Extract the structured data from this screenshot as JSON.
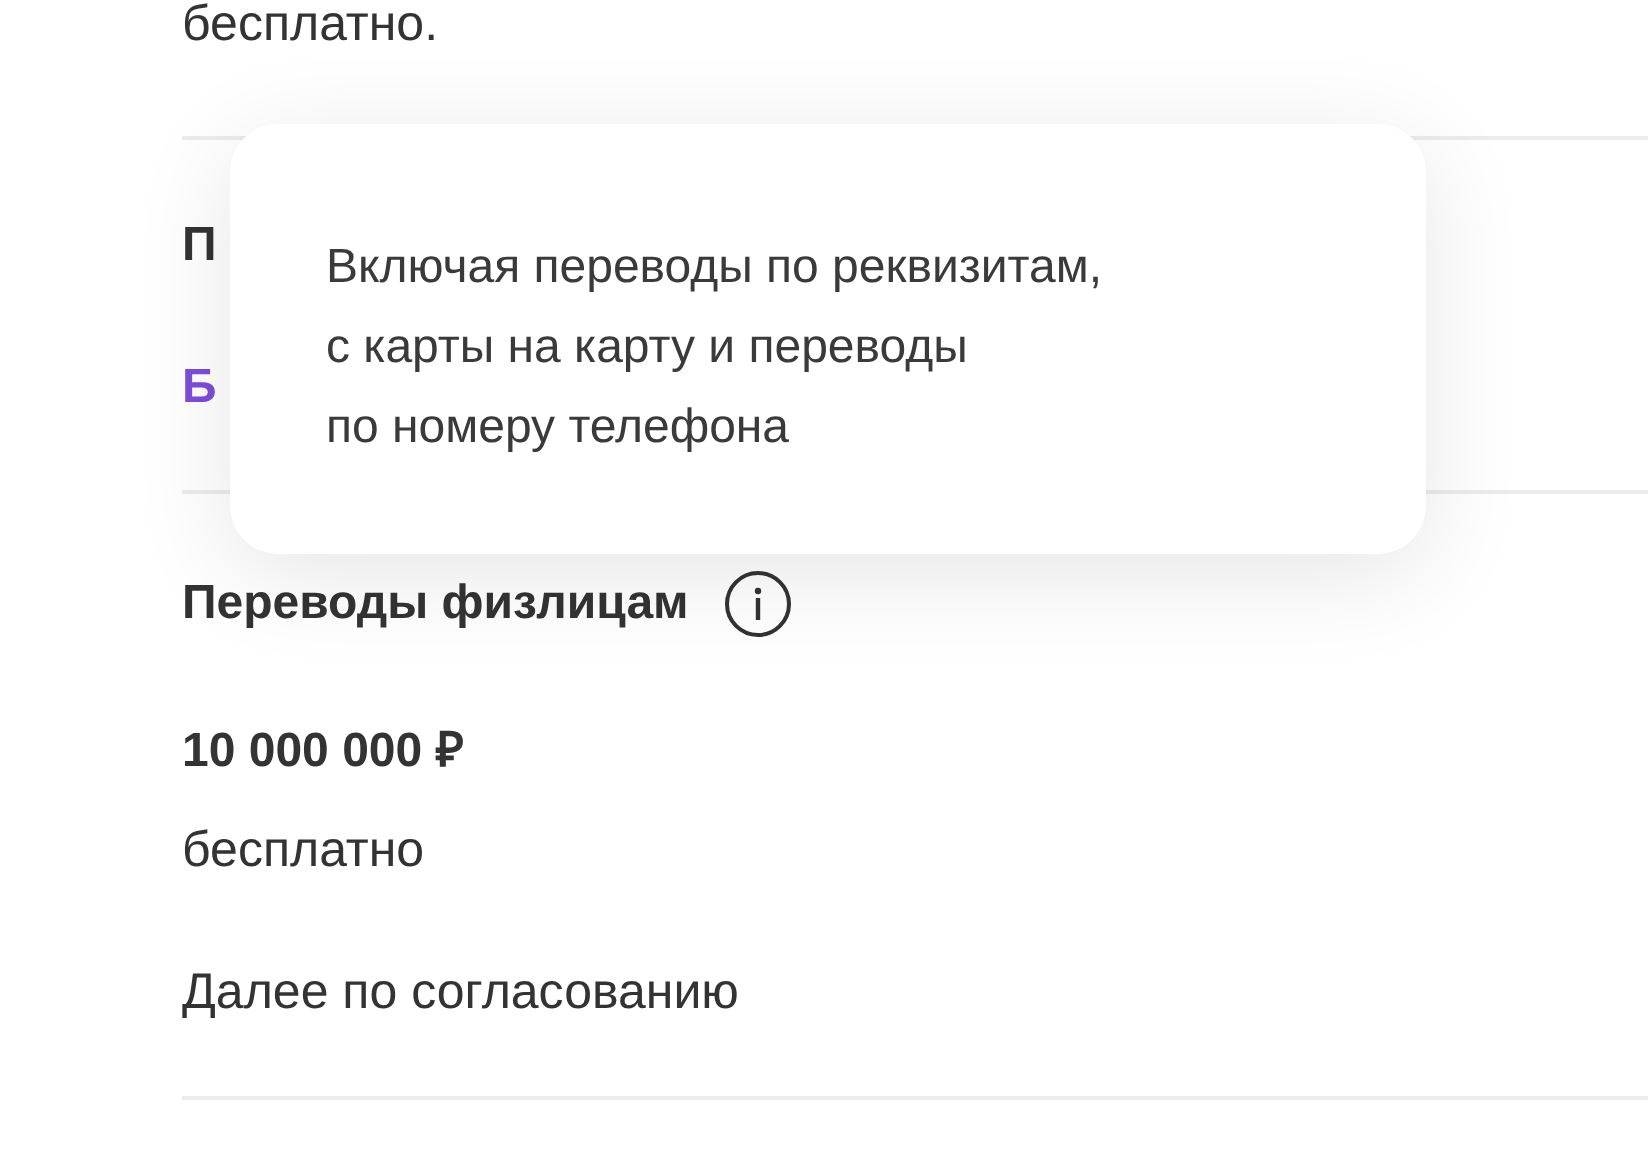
{
  "intro_text": "бесплатно.",
  "hidden_section": {
    "title": "П",
    "value": "Б"
  },
  "tooltip": {
    "lines": [
      "Включая переводы по реквизитам,",
      "с карты на карту и переводы",
      "по номеру телефона"
    ]
  },
  "section": {
    "title": "Переводы физлицам",
    "amount": "10 000 000 ₽",
    "price": "бесплатно",
    "note": "Далее по согласованию"
  }
}
